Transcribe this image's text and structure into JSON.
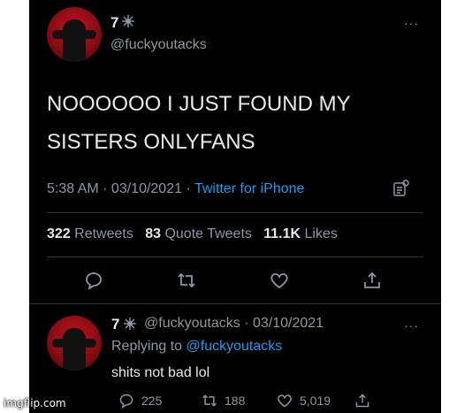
{
  "tweet": {
    "display_name": "7",
    "handle": "@fuckyoutacks",
    "more": "···",
    "text_line1": "NOOOOOO I JUST FOUND MY",
    "text_line2": "SISTERS ONLYFANS",
    "time": "5:38 AM",
    "sep": " · ",
    "date": "03/10/2021",
    "source": "Twitter for iPhone",
    "retweets_count": "322",
    "retweets_label": "Retweets",
    "quotes_count": "83",
    "quotes_label": "Quote Tweets",
    "likes_count": "11.1K",
    "likes_label": "Likes"
  },
  "reply": {
    "display_name": "7",
    "handle": "@fuckyoutacks",
    "date": "· 03/10/2021",
    "more": "···",
    "replying_prefix": "Replying to ",
    "replying_handle": "@fuckyoutacks",
    "text": "shits not bad lol",
    "reply_count": "225",
    "retweet_count": "188",
    "like_count": "5,019"
  },
  "watermark": "imgflip.com",
  "colors": {
    "background": "#000000",
    "text": "#e7e9ea",
    "muted": "#8b98a5",
    "link": "#1d9bf0",
    "avatar": "#c0131b"
  }
}
